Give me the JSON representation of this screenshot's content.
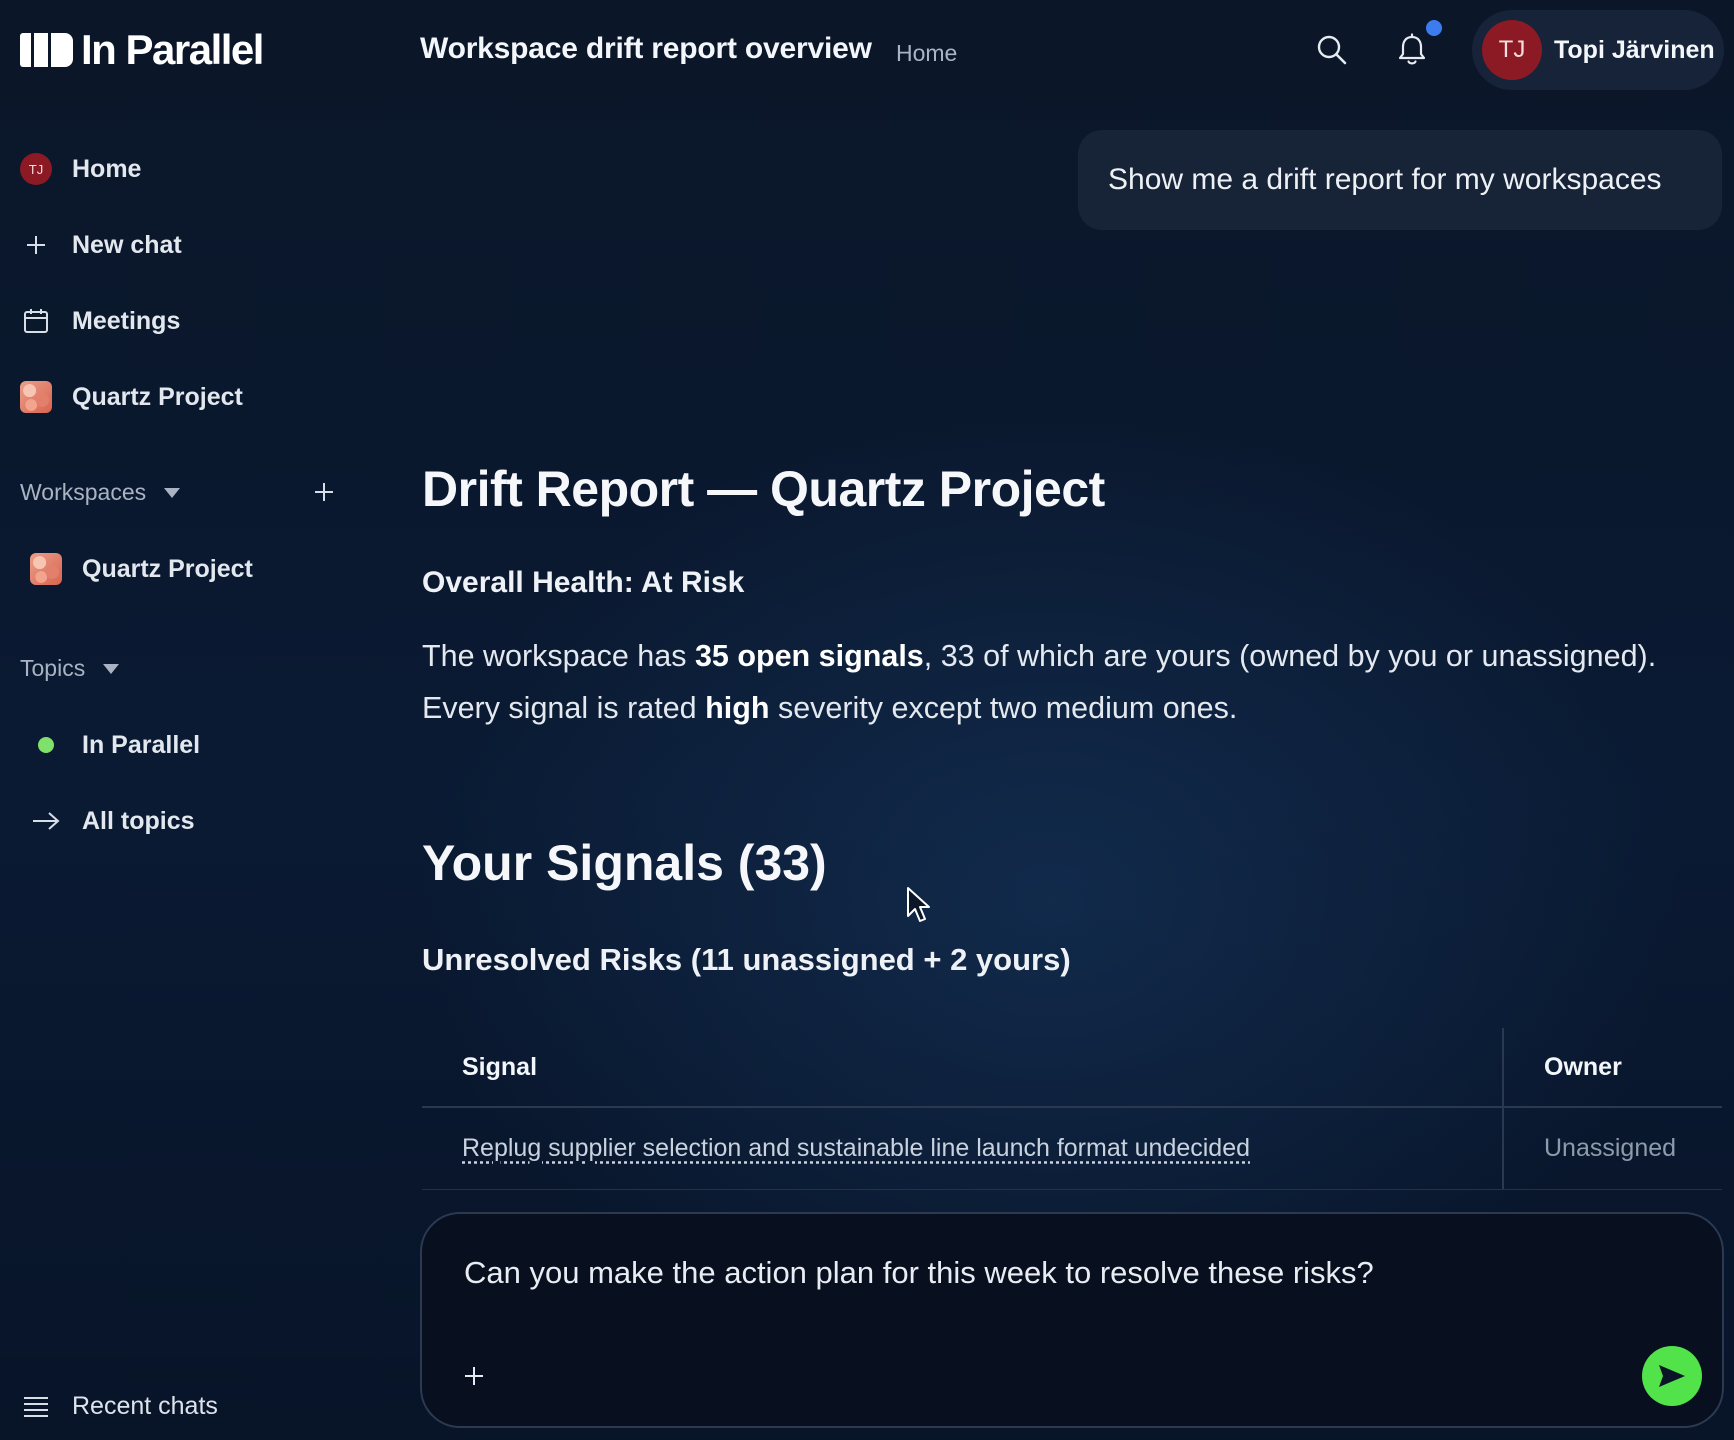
{
  "app": {
    "logo_text": "In Parallel"
  },
  "header": {
    "title": "Workspace drift report overview",
    "breadcrumb": "Home",
    "user": {
      "initials": "TJ",
      "name": "Topi Järvinen"
    },
    "notification_dot_color": "#3c7cf0"
  },
  "sidebar": {
    "items": [
      {
        "label": "Home",
        "icon": "avatar-tj",
        "avatar_initials": "TJ"
      },
      {
        "label": "New chat",
        "icon": "plus-icon"
      },
      {
        "label": "Meetings",
        "icon": "calendar-icon"
      },
      {
        "label": "Quartz Project",
        "icon": "quartz-thumbnail"
      }
    ],
    "workspaces": {
      "label": "Workspaces",
      "items": [
        {
          "label": "Quartz Project"
        }
      ]
    },
    "topics": {
      "label": "Topics",
      "items": [
        {
          "label": "In Parallel",
          "dot_color": "#7fe06a"
        },
        {
          "label": "All topics",
          "icon": "arrow-right-icon"
        }
      ]
    },
    "recent_chats_label": "Recent chats"
  },
  "chat": {
    "user_message": "Show me a drift report for my workspaces",
    "report": {
      "title": "Drift Report — Quartz Project",
      "health": "Overall Health: At Risk",
      "summary": {
        "p1": "The workspace has ",
        "open_signals": "35 open signals",
        "p2": ", 33 of which are yours (owned by you or unassigned). Every signal is rated ",
        "severity": "high",
        "p3": " severity except two medium ones."
      },
      "signals_title": "Your Signals (33)",
      "risks_title": "Unresolved Risks (11 unassigned + 2 yours)",
      "table": {
        "headers": {
          "signal": "Signal",
          "owner": "Owner"
        },
        "rows": [
          {
            "signal": "Replug supplier selection and sustainable line launch format undecided",
            "owner": "Unassigned"
          }
        ]
      }
    }
  },
  "composer": {
    "value": "Can you make the action plan for this week to resolve these risks?",
    "send_color": "#52e24a"
  }
}
